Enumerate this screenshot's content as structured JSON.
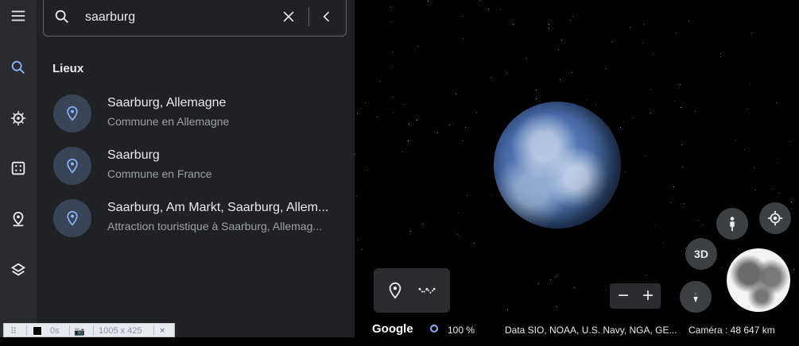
{
  "search": {
    "value": "saarburg",
    "placeholder": "",
    "section_title": "Lieux"
  },
  "results": [
    {
      "title": "Saarburg, Allemagne",
      "subtitle": "Commune en Allemagne"
    },
    {
      "title": "Saarburg",
      "subtitle": "Commune en France"
    },
    {
      "title": "Saarburg, Am Markt, Saarburg, Allem...",
      "subtitle": "Attraction touristique à Saarburg, Allemag..."
    }
  ],
  "rail": [
    "menu-icon",
    "search-icon",
    "voyager-icon",
    "feeling-lucky-icon",
    "projects-icon",
    "map-style-icon",
    "measure-icon"
  ],
  "map": {
    "btn_3d": "3D",
    "zoom_minus": "−",
    "zoom_plus": "+",
    "footer": {
      "logo": "Google",
      "load_pct": "100 %",
      "credits": "Data SIO, NOAA, U.S. Navy, NGA, GE...",
      "camera": "Caméra : 48 647 km"
    }
  },
  "devtools": {
    "time": "0s",
    "size": "1005 x 425",
    "close": "×"
  },
  "colors": {
    "rail_bg": "#2a2b2e",
    "panel_bg": "#202124",
    "pin_bg": "#394457",
    "accent": "#8ab4f8"
  }
}
